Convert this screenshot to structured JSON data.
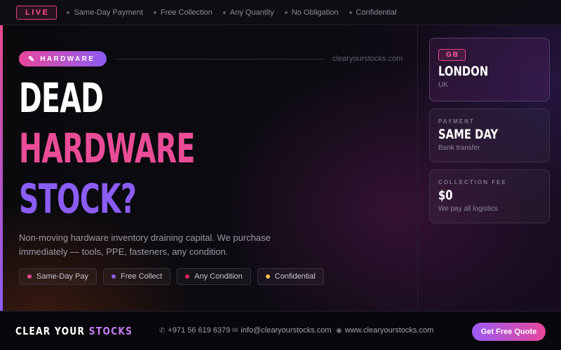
{
  "topbar": {
    "live_label": "LIVE",
    "items": [
      "Same-Day Payment",
      "Free Collection",
      "Any Quantity",
      "No Obligation",
      "Confidential"
    ]
  },
  "hero": {
    "badge_icon": "pencil-icon",
    "badge_label": "HARDWARE",
    "site": "clearyourstocks.com",
    "headline": [
      "DEAD",
      "HARDWARE",
      "STOCK?"
    ],
    "description": "Non-moving hardware inventory draining capital. We purchase immediately — tools, PPE, fasteners, any condition.",
    "chips": [
      {
        "label": "Same-Day Pay",
        "color": "#e8479a"
      },
      {
        "label": "Free Collect",
        "color": "#8b5cf6"
      },
      {
        "label": "Any Condition",
        "color": "#e0245e"
      },
      {
        "label": "Confidential",
        "color": "#f2c14e"
      }
    ]
  },
  "cards": {
    "location": {
      "code": "GB",
      "city": "LONDON",
      "country": "UK"
    },
    "payment": {
      "label": "PAYMENT",
      "value": "SAME DAY",
      "sub": "Bank transfer"
    },
    "fee": {
      "label": "COLLECTION FEE",
      "value": "$0",
      "sub": "We pay all logistics"
    }
  },
  "footer": {
    "brand_white": "CLEAR YOUR",
    "brand_purple": "STOCKS",
    "phone": "+971 56 619 6379",
    "email": "info@clearyourstocks.com",
    "website": "www.clearyourstocks.com",
    "cta": "Get Free Quote"
  },
  "colors": {
    "pink": "#ea4c97",
    "purple": "#8b5cf6",
    "background": "#0b0a10"
  }
}
